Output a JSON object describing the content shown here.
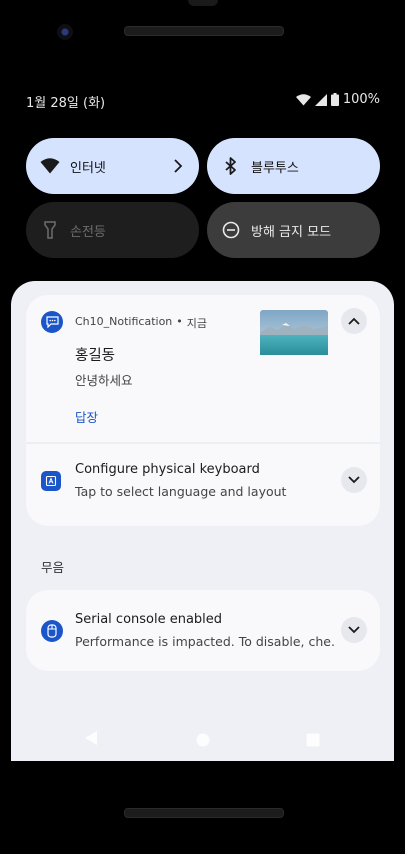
{
  "status_bar": {
    "date": "1월 28일 (화)",
    "battery": "100%"
  },
  "quick_tiles": [
    {
      "label": "인터넷",
      "icon": "wifi-icon"
    },
    {
      "label": "블루투스",
      "icon": "bluetooth-icon"
    },
    {
      "label": "손전등",
      "icon": "flashlight-icon"
    },
    {
      "label": "방해 금지 모드",
      "icon": "do-not-disturb-icon"
    }
  ],
  "notifications": {
    "message": {
      "app_name": "Ch10_Notification",
      "time": "지금",
      "sender": "홍길동",
      "text": "안녕하세요",
      "action": "답장"
    },
    "keyboard": {
      "title": "Configure physical keyboard",
      "text": "Tap to select language and layout"
    },
    "section_label": "무음",
    "serial": {
      "title": "Serial console enabled",
      "text": "Performance is impacted. To disable, che.."
    }
  },
  "colors": {
    "accent": "#1a56c9",
    "tile_on": "#d6e3ff",
    "shade": "#eef0f5"
  }
}
